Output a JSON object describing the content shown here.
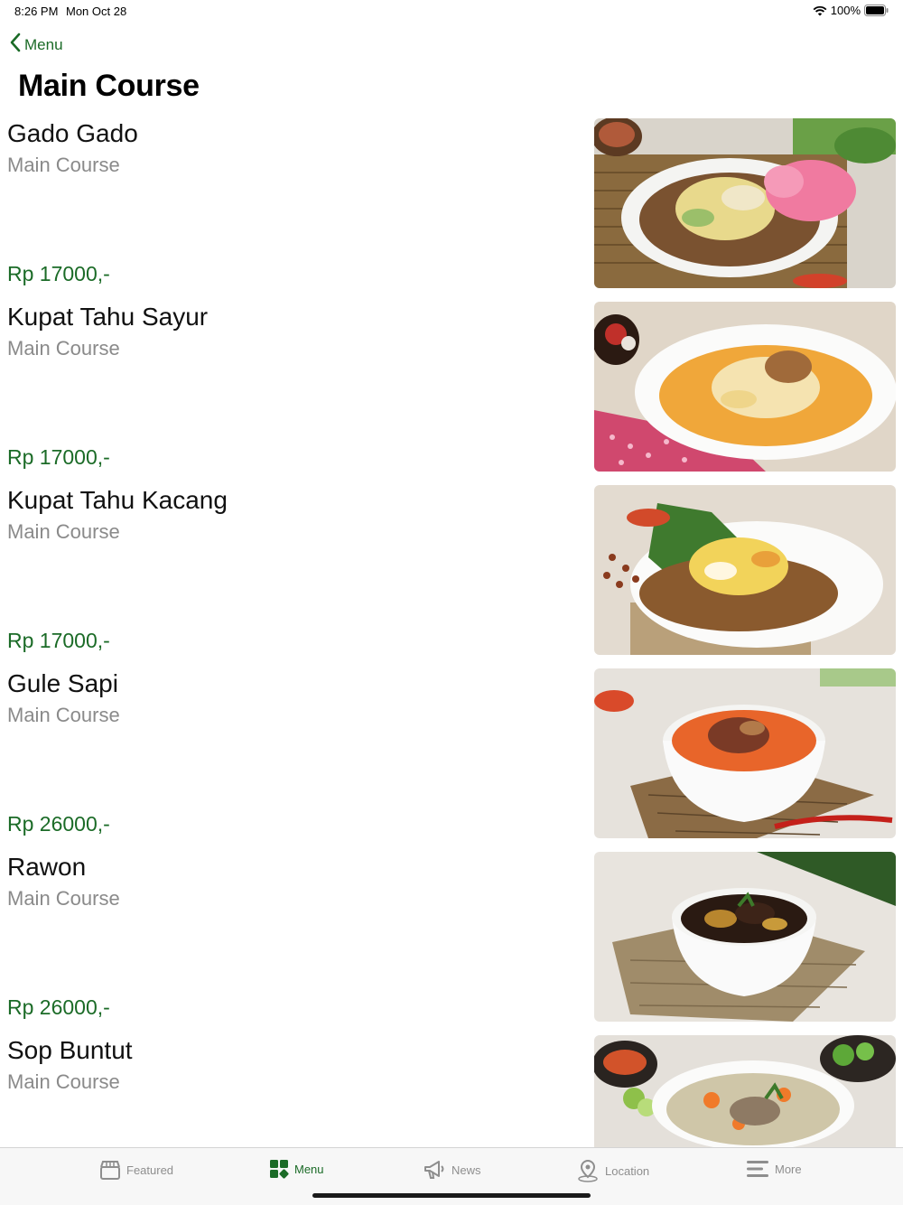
{
  "status_bar": {
    "time": "8:26 PM",
    "date": "Mon Oct 28",
    "battery": "100%"
  },
  "nav": {
    "back_label": "Menu"
  },
  "page": {
    "title": "Main Course"
  },
  "items": [
    {
      "name": "Gado Gado",
      "category": "Main Course",
      "price": "Rp 17000,-"
    },
    {
      "name": "Kupat Tahu Sayur",
      "category": "Main Course",
      "price": "Rp 17000,-"
    },
    {
      "name": "Kupat Tahu Kacang",
      "category": "Main Course",
      "price": "Rp 17000,-"
    },
    {
      "name": "Gule Sapi",
      "category": "Main Course",
      "price": "Rp 26000,-"
    },
    {
      "name": "Rawon",
      "category": "Main Course",
      "price": "Rp 26000,-"
    },
    {
      "name": "Sop Buntut",
      "category": "Main Course",
      "price": ""
    }
  ],
  "tabs": [
    {
      "label": "Featured",
      "icon": "storefront-icon",
      "active": false
    },
    {
      "label": "Menu",
      "icon": "grid-icon",
      "active": true
    },
    {
      "label": "News",
      "icon": "megaphone-icon",
      "active": false
    },
    {
      "label": "Location",
      "icon": "pin-icon",
      "active": false
    },
    {
      "label": "More",
      "icon": "list-icon",
      "active": false
    }
  ],
  "colors": {
    "accent": "#1b6b27",
    "secondary_text": "#8a8a8a",
    "tab_inactive": "#8e8e8e"
  }
}
